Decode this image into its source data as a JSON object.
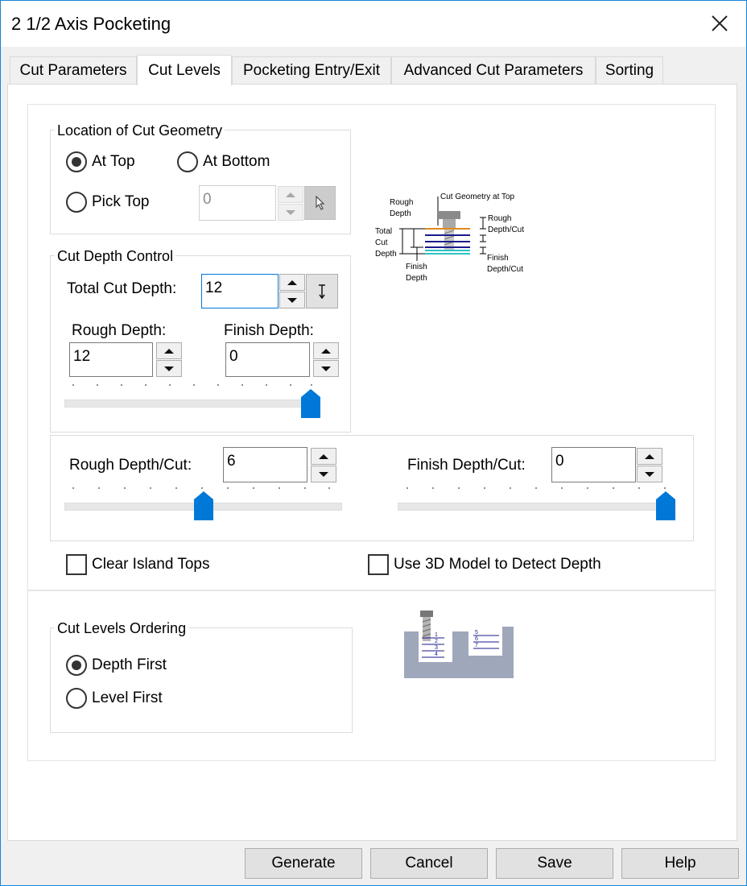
{
  "window": {
    "title": "2 1/2 Axis Pocketing"
  },
  "tabs": [
    {
      "label": "Cut Parameters"
    },
    {
      "label": "Cut Levels"
    },
    {
      "label": "Pocketing Entry/Exit"
    },
    {
      "label": "Advanced Cut Parameters"
    },
    {
      "label": "Sorting"
    }
  ],
  "active_tab": "Cut Levels",
  "location": {
    "title": "Location of Cut Geometry",
    "at_top": "At Top",
    "at_bottom": "At Bottom",
    "pick_top": "Pick Top",
    "pick_top_value": "0",
    "selected": "At Top"
  },
  "depth_control": {
    "title": "Cut Depth Control",
    "total_label": "Total Cut Depth:",
    "total_value": "12",
    "rough_label": "Rough Depth:",
    "rough_value": "12",
    "finish_label": "Finish Depth:",
    "finish_value": "0",
    "slider_fraction": 1.0
  },
  "per_cut": {
    "rough_label": "Rough Depth/Cut:",
    "rough_value": "6",
    "rough_slider_fraction": 0.5,
    "finish_label": "Finish Depth/Cut:",
    "finish_value": "0",
    "finish_slider_fraction": 1.0
  },
  "options": {
    "clear_island_tops": "Clear Island Tops",
    "clear_island_tops_checked": false,
    "use_3d_model": "Use 3D Model to Detect Depth",
    "use_3d_model_checked": false
  },
  "diagram": {
    "cut_geometry_at_top": "Cut Geometry at Top",
    "rough_depth": [
      "Rough",
      "Depth"
    ],
    "total_cut_depth": [
      "Total",
      "Cut",
      "Depth"
    ],
    "finish_depth": [
      "Finish",
      "Depth"
    ],
    "rough_depth_cut": [
      "Rough",
      "Depth/Cut"
    ],
    "finish_depth_cut": [
      "Finish",
      "Depth/Cut"
    ]
  },
  "ordering": {
    "title": "Cut Levels Ordering",
    "depth_first": "Depth First",
    "level_first": "Level First",
    "selected": "Depth First",
    "diagram_levels": [
      "1",
      "2",
      "3",
      "4",
      "5",
      "6",
      "7"
    ]
  },
  "buttons": {
    "generate": "Generate",
    "cancel": "Cancel",
    "save": "Save",
    "help": "Help"
  },
  "colors": {
    "accent": "#0078d7",
    "slider_thumb": "#0078d7",
    "cut_top_line": "#e08a1e",
    "rough_lines": "#1a1a8c",
    "finish_lines": "#2ec4c4"
  }
}
